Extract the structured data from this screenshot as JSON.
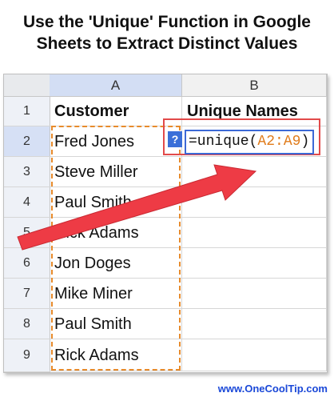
{
  "headline": {
    "line1": "Use the 'Unique' Function in Google",
    "line2": "Sheets to Extract Distinct Values"
  },
  "sheet": {
    "columns": [
      "A",
      "B"
    ],
    "rows": [
      "1",
      "2",
      "3",
      "4",
      "5",
      "6",
      "7",
      "8",
      "9"
    ],
    "header_cells": {
      "a1": "Customer",
      "b1": "Unique Names"
    },
    "customers": [
      "Fred Jones",
      "Steve Miller",
      "Paul Smith",
      "Rick Adams",
      "Jon Doges",
      "Mike Miner",
      "Paul Smith",
      "Rick Adams"
    ],
    "formula": {
      "help_badge": "?",
      "prefix": "=unique(",
      "range": "A2:A9",
      "suffix": ")"
    }
  },
  "footer": "www.OneCoolTip.com",
  "colors": {
    "selection_blue": "#3c69d6",
    "range_orange": "#e78b2c",
    "arrow_red": "#ee3b45"
  }
}
